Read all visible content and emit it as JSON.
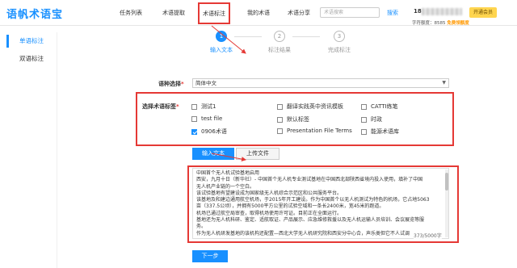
{
  "header": {
    "logo": "语帆术语宝",
    "nav": [
      "任务列表",
      "术语提取",
      "术语标注",
      "我的术语",
      "术语分享"
    ],
    "active_nav": "术语标注",
    "search_placeholder": "术语搜索",
    "search_label": "搜索",
    "user_prefix": "18",
    "vip_label": "开通会员",
    "char_info_prefix": "字符额度：8585",
    "char_info_free": "免费领额度"
  },
  "sidebar": {
    "items": [
      {
        "label": "单语标注",
        "active": true
      },
      {
        "label": "双语标注",
        "active": false
      }
    ]
  },
  "steps": [
    {
      "num": "1",
      "label": "输入文本",
      "active": true
    },
    {
      "num": "2",
      "label": "标注结果",
      "active": false
    },
    {
      "num": "3",
      "label": "完成标注",
      "active": false
    }
  ],
  "form": {
    "lang_label": "语种选择",
    "lang_value": "简体中文",
    "tag_label": "选择术语标签",
    "required_mark": "*",
    "tags": [
      {
        "label": "测试1",
        "checked": false
      },
      {
        "label": "翻译实践英中资讯模板",
        "checked": false
      },
      {
        "label": "CATTI练笔",
        "checked": false
      },
      {
        "label": "test file",
        "checked": false
      },
      {
        "label": "默认标签",
        "checked": false
      },
      {
        "label": "时政",
        "checked": false
      },
      {
        "label": "0906术语",
        "checked": true
      },
      {
        "label": "Presentation File Terms",
        "checked": false
      },
      {
        "label": "能源术语库",
        "checked": false
      }
    ],
    "tab_input": "输入文本",
    "tab_upload": "上传文件",
    "text_lines": [
      "中国首个无人机试验基地启用",
      "西安，九月十日（新华社）- 中国首个无人机专业测试基地在中国西北部陕西省境内投入使用，填补了中国",
      "无人机产业链的一个空白。",
      "该试验基地有望建设成为国家级无人机综合示范区和公共服务平台。",
      "该基地及和建边通用航空机场，于2015年开工建设。作为中国首个以无人机测试为特色的机场，它占地5063",
      "亩（337.5公顷），并拥有5000平方公里的试验空域和一条长2400米，宽45米的跑道。",
      "机场已通过航空局审查，取得机场使用许可证。目前正在全面运行。",
      "基地还为无人机科研、鉴定、适航取证、产品展示、应急维修救援以及无人机运输人员培训、会议展览等服",
      "务。",
      "作为无人机研发基地的该机构还配置—西北大学无人机研究院和西安分中心合，声乐类但它不人试调"
    ],
    "counter": "373/5000字",
    "next_label": "下一步"
  }
}
